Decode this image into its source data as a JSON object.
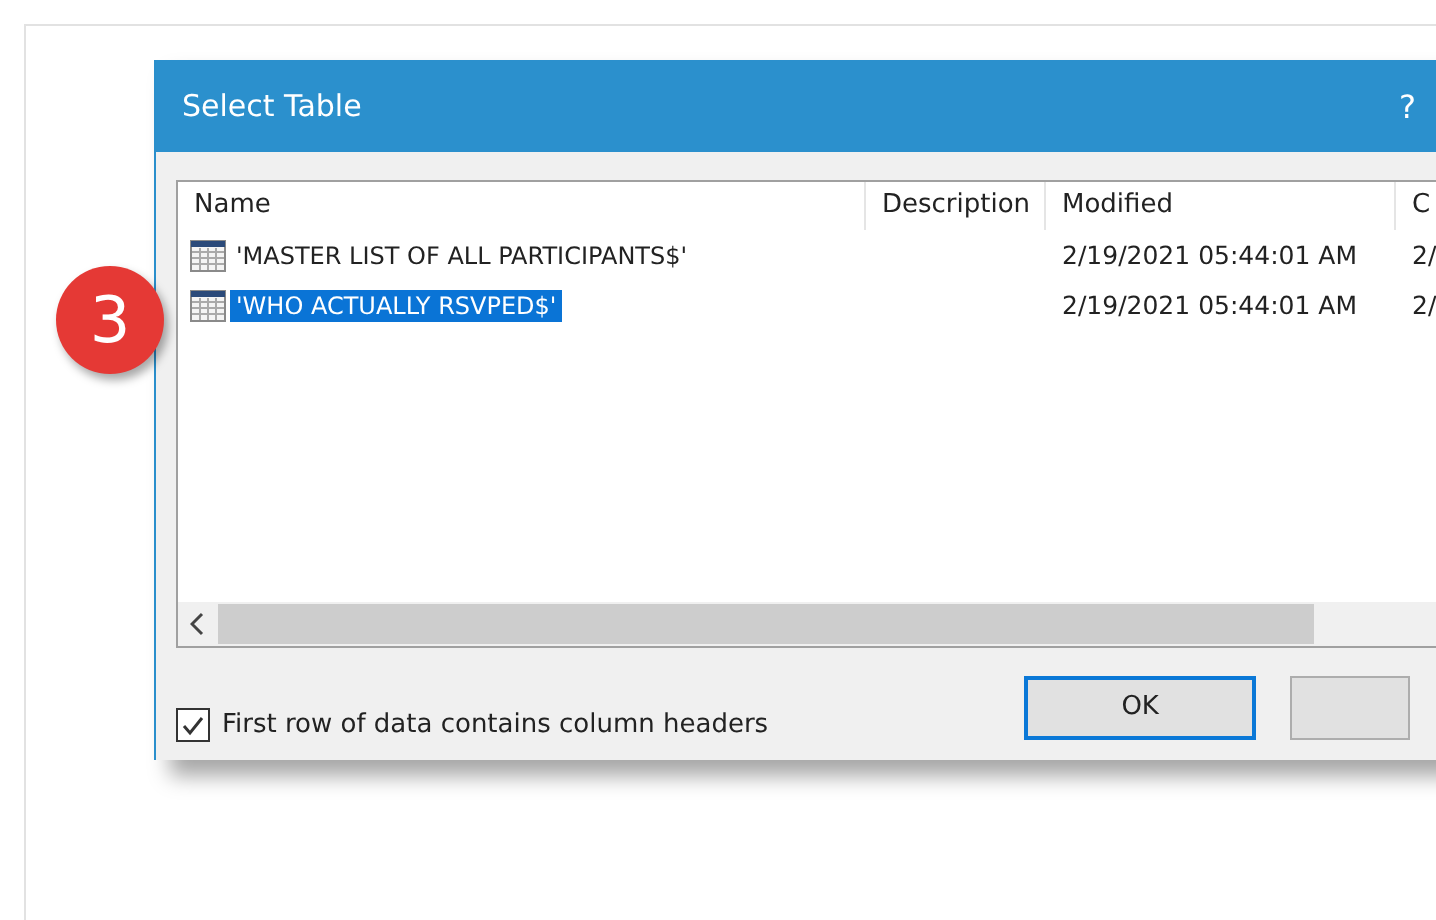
{
  "badge": "3",
  "window": {
    "title": "Select Table",
    "help": "?"
  },
  "table": {
    "columns": [
      "Name",
      "Description",
      "Modified",
      "C"
    ],
    "rows": [
      {
        "name": "'MASTER LIST OF ALL PARTICIPANTS$'",
        "modified": "2/19/2021 05:44:01 AM",
        "column_4": "2/",
        "selected": false
      },
      {
        "name": "'WHO ACTUALLY RSVPED$'",
        "modified": "2/19/2021 05:44:01 AM",
        "column_4": "2/",
        "selected": true
      }
    ]
  },
  "header_checkbox": {
    "label": "First row of data contains column headers",
    "checked": true
  },
  "buttons": [
    {
      "label": "OK",
      "default": true
    },
    {
      "default": false
    }
  ]
}
